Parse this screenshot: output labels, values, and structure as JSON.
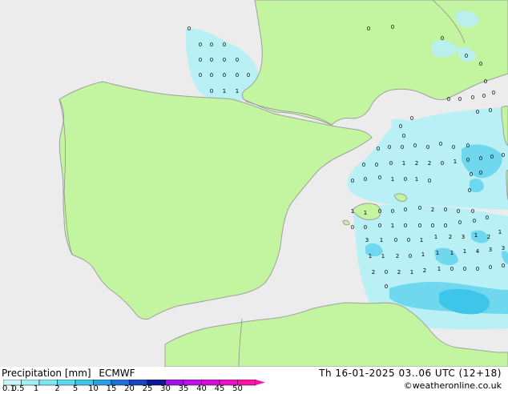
{
  "title": "Precipitation [mm]",
  "model": "ECMWF",
  "valid_time": "Th 16-01-2025 03..06 UTC (12+18)",
  "credit": "©weatheronline.co.uk",
  "legend": {
    "ticks": [
      "0.1",
      "0.5",
      "1",
      "2",
      "5",
      "10",
      "15",
      "20",
      "25",
      "30",
      "35",
      "40",
      "45",
      "50"
    ],
    "colors": [
      "#c8f5fa",
      "#a0eef5",
      "#7ee6f2",
      "#5cd8ee",
      "#3ec6ea",
      "#2a9fe6",
      "#1f6fd6",
      "#1a46c0",
      "#0c1a96",
      "#a010e8",
      "#c010e8",
      "#d80ad8",
      "#ee10c8",
      "#ff10a8"
    ]
  },
  "colors": {
    "sea": "#ececec",
    "land": "#c3f4a0",
    "coast": "#a0a0a0",
    "border": "#909090",
    "light_rain": "#b8f0f5",
    "moderate_rain": "#70d8ee"
  },
  "precip_labels": [
    {
      "t": "0"
    },
    {
      "t": "0"
    },
    {
      "t": "0"
    },
    {
      "t": "0"
    },
    {
      "t": "0"
    },
    {
      "t": "0"
    },
    {
      "t": "0"
    },
    {
      "t": "0"
    },
    {
      "t": "0"
    },
    {
      "t": "0"
    },
    {
      "t": "0"
    },
    {
      "t": "0"
    },
    {
      "t": "0"
    },
    {
      "t": "1"
    },
    {
      "t": "0"
    },
    {
      "t": "1"
    },
    {
      "t": "0"
    },
    {
      "t": "0"
    },
    {
      "t": "0"
    },
    {
      "t": "0"
    },
    {
      "t": "0"
    },
    {
      "t": "0"
    },
    {
      "t": "0"
    },
    {
      "t": "0"
    },
    {
      "t": "0"
    },
    {
      "t": "0"
    },
    {
      "t": "0"
    },
    {
      "t": "0"
    },
    {
      "t": "0"
    },
    {
      "t": "0"
    },
    {
      "t": "0"
    },
    {
      "t": "0"
    },
    {
      "t": "0"
    },
    {
      "t": "0"
    },
    {
      "t": "0"
    },
    {
      "t": "0"
    },
    {
      "t": "0"
    },
    {
      "t": "0"
    },
    {
      "t": "0"
    },
    {
      "t": "0"
    },
    {
      "t": "0"
    },
    {
      "t": "0"
    },
    {
      "t": "0"
    },
    {
      "t": "1"
    },
    {
      "t": "2"
    },
    {
      "t": "2"
    },
    {
      "t": "0"
    },
    {
      "t": "1"
    },
    {
      "t": "0"
    },
    {
      "t": "0"
    },
    {
      "t": "0"
    },
    {
      "t": "0"
    },
    {
      "t": "0"
    },
    {
      "t": "0"
    },
    {
      "t": "0"
    },
    {
      "t": "0"
    },
    {
      "t": "0"
    },
    {
      "t": "0"
    },
    {
      "t": "1"
    },
    {
      "t": "0"
    },
    {
      "t": "1"
    },
    {
      "t": "0"
    },
    {
      "t": "1"
    },
    {
      "t": "1"
    },
    {
      "t": "0"
    },
    {
      "t": "0"
    },
    {
      "t": "0"
    },
    {
      "t": "0"
    },
    {
      "t": "2"
    },
    {
      "t": "0"
    },
    {
      "t": "0"
    },
    {
      "t": "0"
    },
    {
      "t": "0"
    },
    {
      "t": "0"
    },
    {
      "t": "0"
    },
    {
      "t": "1"
    },
    {
      "t": "0"
    },
    {
      "t": "0"
    },
    {
      "t": "0"
    },
    {
      "t": "0"
    },
    {
      "t": "0"
    },
    {
      "t": "0"
    },
    {
      "t": "0"
    },
    {
      "t": "3"
    },
    {
      "t": "1"
    },
    {
      "t": "0"
    },
    {
      "t": "0"
    },
    {
      "t": "1"
    },
    {
      "t": "1"
    },
    {
      "t": "2"
    },
    {
      "t": "3"
    },
    {
      "t": "1"
    },
    {
      "t": "2"
    },
    {
      "t": "1"
    },
    {
      "t": "1"
    },
    {
      "t": "1"
    },
    {
      "t": "2"
    },
    {
      "t": "0"
    },
    {
      "t": "1"
    },
    {
      "t": "1"
    },
    {
      "t": "1"
    },
    {
      "t": "1"
    },
    {
      "t": "4"
    },
    {
      "t": "3"
    },
    {
      "t": "3"
    },
    {
      "t": "2"
    },
    {
      "t": "0"
    },
    {
      "t": "2"
    },
    {
      "t": "1"
    },
    {
      "t": "2"
    },
    {
      "t": "1"
    },
    {
      "t": "0"
    },
    {
      "t": "0"
    },
    {
      "t": "0"
    },
    {
      "t": "0"
    },
    {
      "t": "0"
    },
    {
      "t": "0"
    }
  ]
}
